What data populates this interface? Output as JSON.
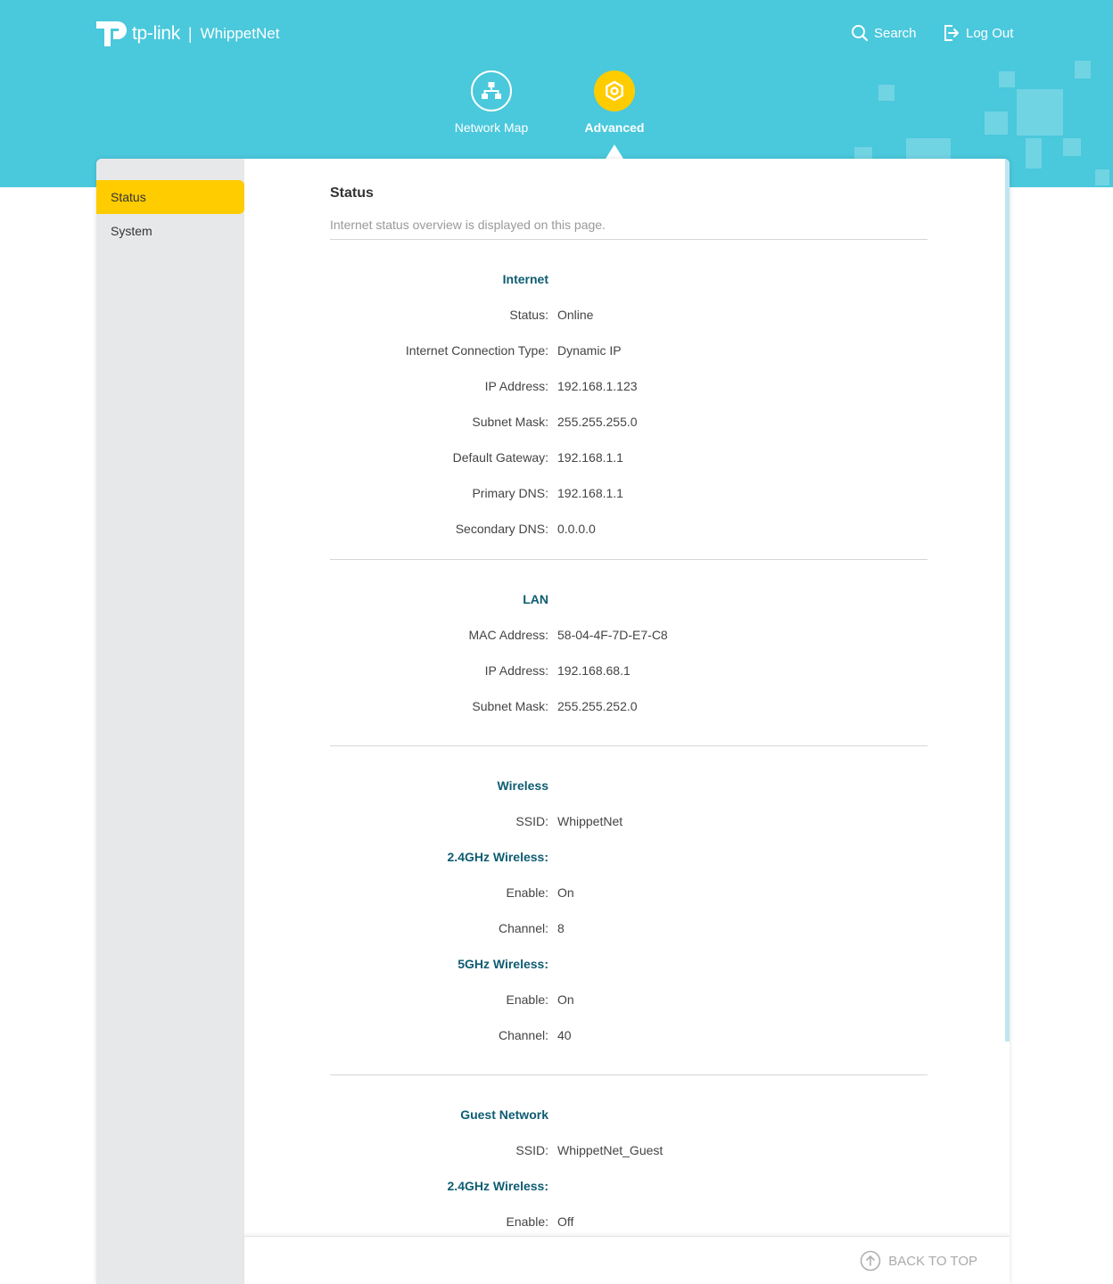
{
  "header": {
    "brand": "tp-link",
    "network_name": "WhippetNet",
    "search_label": "Search",
    "logout_label": "Log Out",
    "tabs": [
      {
        "label": "Network Map",
        "icon": "network-map-icon"
      },
      {
        "label": "Advanced",
        "icon": "gear-icon",
        "active": true
      }
    ]
  },
  "sidebar": {
    "items": [
      {
        "label": "Status",
        "active": true
      },
      {
        "label": "System"
      }
    ]
  },
  "main": {
    "title": "Status",
    "description": "Internet status overview is displayed on this page.",
    "internet": {
      "heading": "Internet",
      "rows": [
        {
          "label": "Status:",
          "value": "Online"
        },
        {
          "label": "Internet Connection Type:",
          "value": "Dynamic IP"
        },
        {
          "label": "IP Address:",
          "value": "192.168.1.123"
        },
        {
          "label": "Subnet Mask:",
          "value": "255.255.255.0"
        },
        {
          "label": "Default Gateway:",
          "value": "192.168.1.1"
        },
        {
          "label": "Primary DNS:",
          "value": "192.168.1.1"
        },
        {
          "label": "Secondary DNS:",
          "value": "0.0.0.0"
        }
      ]
    },
    "lan": {
      "heading": "LAN",
      "rows": [
        {
          "label": "MAC Address:",
          "value": "58-04-4F-7D-E7-C8"
        },
        {
          "label": "IP Address:",
          "value": "192.168.68.1"
        },
        {
          "label": "Subnet Mask:",
          "value": "255.255.252.0"
        }
      ]
    },
    "wireless": {
      "heading": "Wireless",
      "ssid_label": "SSID:",
      "ssid": "WhippetNet",
      "band24_label": "2.4GHz Wireless:",
      "band24_enable_label": "Enable:",
      "band24_enable": "On",
      "band24_channel_label": "Channel:",
      "band24_channel": "8",
      "band5_label": "5GHz Wireless:",
      "band5_enable_label": "Enable:",
      "band5_enable": "On",
      "band5_channel_label": "Channel:",
      "band5_channel": "40"
    },
    "guest": {
      "heading": "Guest Network",
      "ssid_label": "SSID:",
      "ssid": "WhippetNet_Guest",
      "band24_label": "2.4GHz Wireless:",
      "band24_enable_label": "Enable:",
      "band24_enable": "Off"
    }
  },
  "footer": {
    "back_to_top": "BACK TO TOP"
  },
  "colors": {
    "banner": "#4ac8dc",
    "accent": "#ffcc00",
    "section_heading": "#0e5c72",
    "sidebar_bg": "#e7e8ea"
  }
}
